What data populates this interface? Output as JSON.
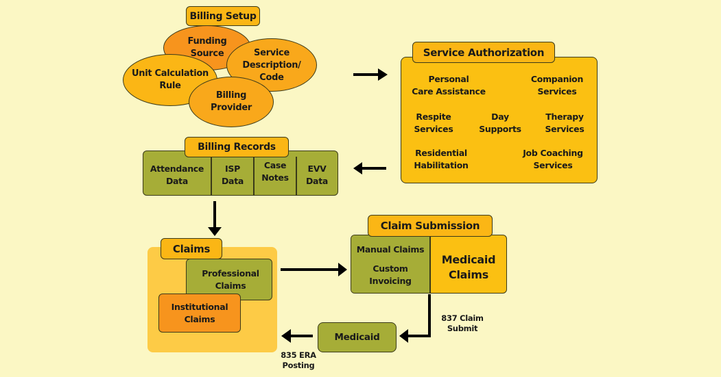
{
  "billing_setup": {
    "title": "Billing Setup",
    "items": [
      "Funding Source",
      "Service Description/ Code",
      "Unit Calculation Rule",
      "Billing Provider"
    ],
    "funding_source": [
      "Funding",
      "Source"
    ],
    "service_description": [
      "Service",
      "Description/",
      "Code"
    ],
    "unit_calculation": [
      "Unit Calculation",
      "Rule"
    ],
    "billing_provider": [
      "Billing",
      "Provider"
    ]
  },
  "service_authorization": {
    "title": "Service Authorization",
    "services": [
      [
        "Personal",
        "Care Assistance"
      ],
      [
        "Companion",
        "Services"
      ],
      [
        "Respite",
        "Services"
      ],
      [
        "Day",
        "Supports"
      ],
      [
        "Therapy",
        "Services"
      ],
      [
        "Residential",
        "Habilitation"
      ],
      [
        "Job Coaching",
        "Services"
      ]
    ]
  },
  "billing_records": {
    "title": "Billing Records",
    "columns": [
      [
        "Attendance",
        "Data"
      ],
      [
        "ISP",
        "Data"
      ],
      [
        "Case",
        "Notes"
      ],
      [
        "EVV",
        "Data"
      ]
    ]
  },
  "claims": {
    "title": "Claims",
    "professional": [
      "Professional",
      "Claims"
    ],
    "institutional": [
      "Institutional",
      "Claims"
    ]
  },
  "claim_submission": {
    "title": "Claim Submission",
    "manual_claims": "Manual Claims",
    "custom_invoicing": [
      "Custom",
      "Invoicing"
    ],
    "medicaid_claims": [
      "Medicaid",
      "Claims"
    ]
  },
  "medicaid": {
    "label": "Medicaid"
  },
  "notes": {
    "claim_submit": [
      "837 Claim",
      "Submit"
    ],
    "era_posting": [
      "835 ERA",
      "Posting"
    ]
  },
  "colors": {
    "background": "#fbf7c4",
    "tab": "#fbb615",
    "orange": "#f7941d",
    "light_orange": "#f9a81b",
    "yellow": "#fbc012",
    "green": "#a6ad37",
    "claims_bg": "#fdcb46"
  }
}
